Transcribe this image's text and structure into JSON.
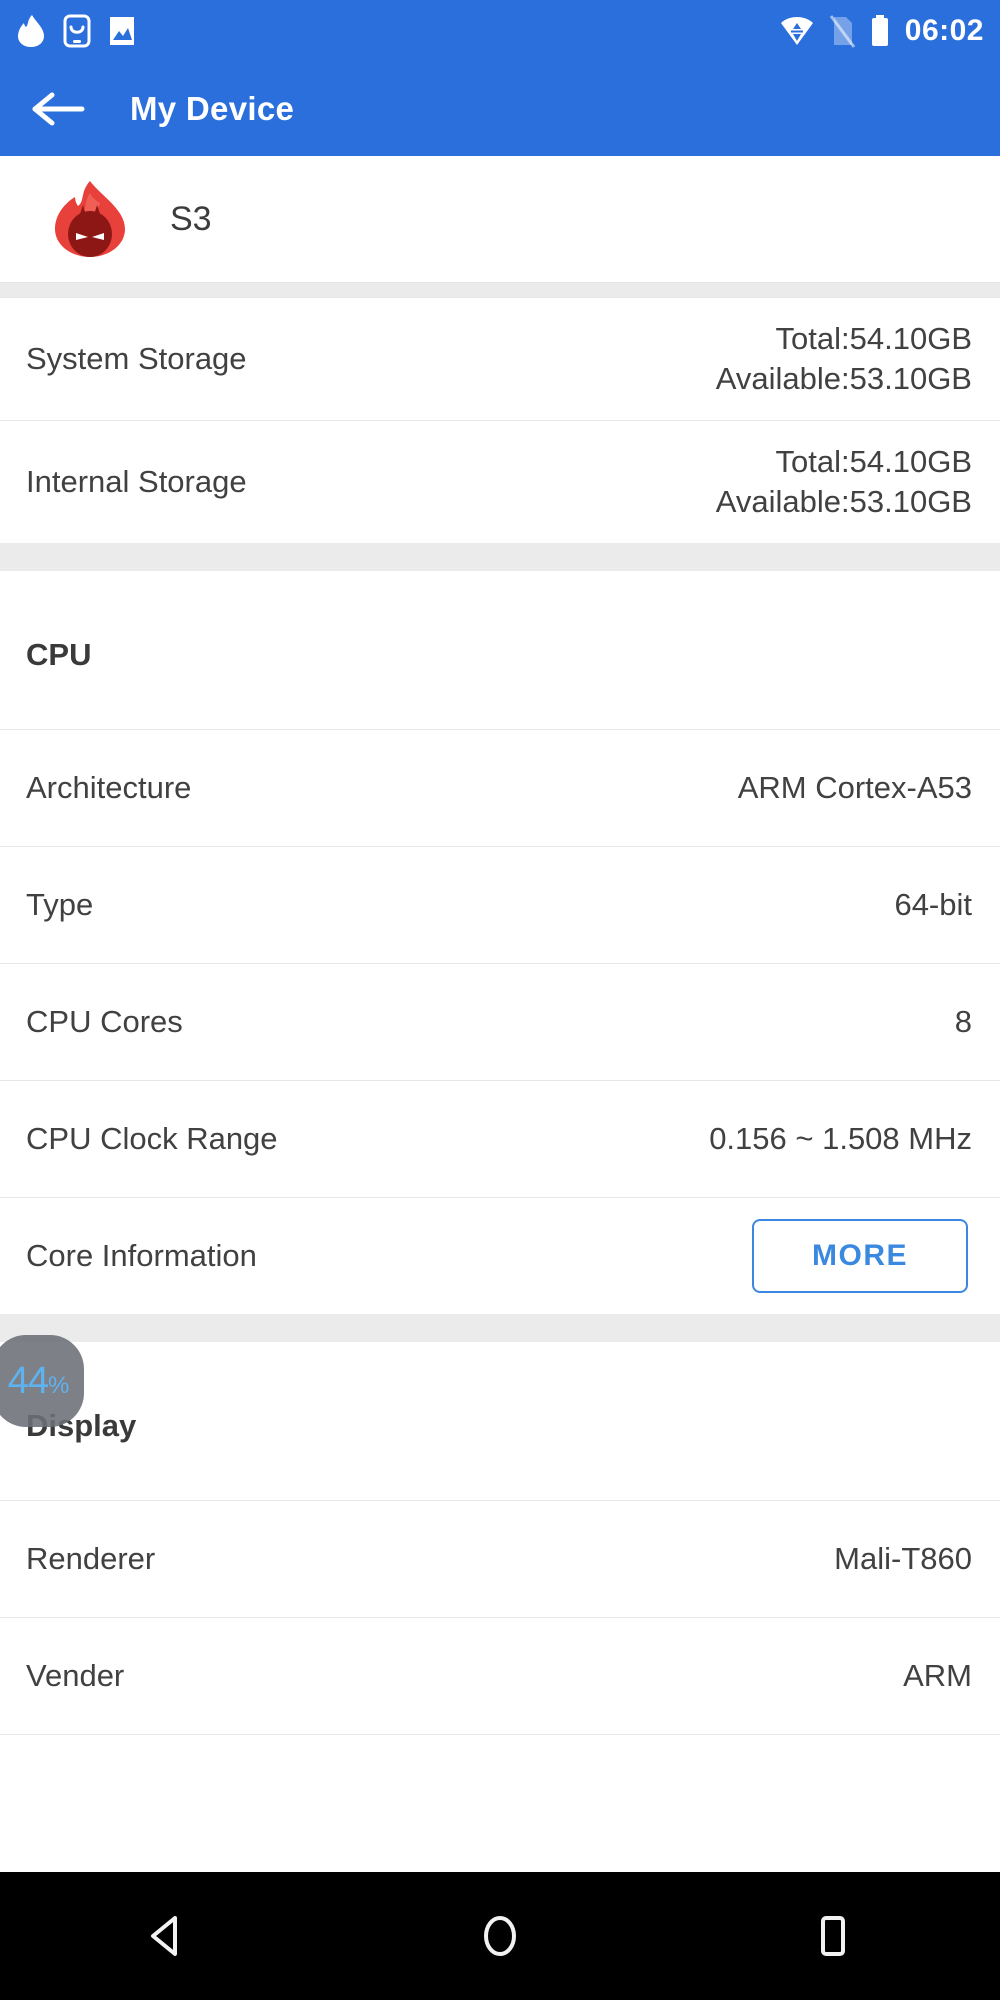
{
  "status_bar": {
    "left_icons": [
      "antutu-flame-icon",
      "smiley-app-icon",
      "gallery-image-icon"
    ],
    "right_icons": [
      "wifi-data-icon",
      "no-sim-icon",
      "battery-icon"
    ],
    "time": "06:02"
  },
  "app_bar": {
    "back_icon": "back-arrow-icon",
    "title": "My Device"
  },
  "device": {
    "logo_icon": "antutu-logo-icon",
    "name": "S3"
  },
  "storage": [
    {
      "label": "System Storage",
      "total": "Total:54.10GB",
      "available": "Available:53.10GB"
    },
    {
      "label": "Internal Storage",
      "total": "Total:54.10GB",
      "available": "Available:53.10GB"
    }
  ],
  "cpu": {
    "title": "CPU",
    "rows": [
      {
        "label": "Architecture",
        "value": "ARM Cortex-A53"
      },
      {
        "label": "Type",
        "value": "64-bit"
      },
      {
        "label": "CPU Cores",
        "value": "8"
      },
      {
        "label": "CPU Clock Range",
        "value": "0.156 ~ 1.508 MHz"
      }
    ],
    "core_info_label": "Core Information",
    "more_label": "MORE"
  },
  "display": {
    "title": "Display",
    "rows": [
      {
        "label": "Renderer",
        "value": "Mali-T860"
      },
      {
        "label": "Vender",
        "value": "ARM"
      }
    ]
  },
  "floating_badge": {
    "value": "44",
    "unit": "%"
  },
  "nav_bar": {
    "back": "nav-back-icon",
    "home": "nav-home-icon",
    "recents": "nav-recents-icon"
  },
  "colors": {
    "primary": "#2a6fdb",
    "accent": "#3b88e0",
    "badge_text": "#49a8ee",
    "band": "#ebebeb"
  }
}
